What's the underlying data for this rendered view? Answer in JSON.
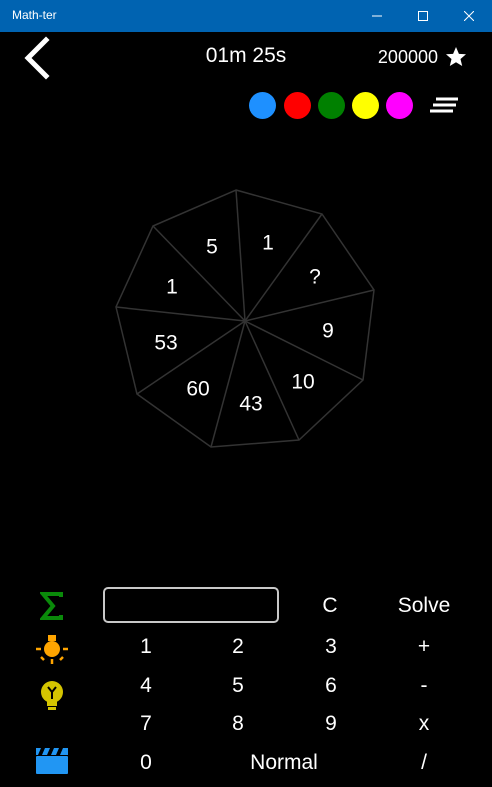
{
  "window": {
    "title": "Math-ter"
  },
  "header": {
    "timer": "01m 25s",
    "score": "200000"
  },
  "colors": {
    "titlebar": "#0063b1",
    "palette": [
      "#1e90ff",
      "#ff0000",
      "#008000",
      "#ffff00",
      "#ff00ff"
    ]
  },
  "puzzle": {
    "values": [
      "1",
      "?",
      "9",
      "10",
      "43",
      "60",
      "53",
      "1",
      "5"
    ]
  },
  "keypad": {
    "clear": "C",
    "solve": "Solve",
    "digits": [
      "1",
      "2",
      "3",
      "4",
      "5",
      "6",
      "7",
      "8",
      "9",
      "0"
    ],
    "mode": "Normal",
    "ops": [
      "+",
      "-",
      "x",
      "/"
    ]
  },
  "icons": {
    "sum": "sigma-icon",
    "hint": "lightbulb-icon",
    "hint2": "bulb-y-icon",
    "video": "clapperboard-icon"
  },
  "input": {
    "value": ""
  }
}
